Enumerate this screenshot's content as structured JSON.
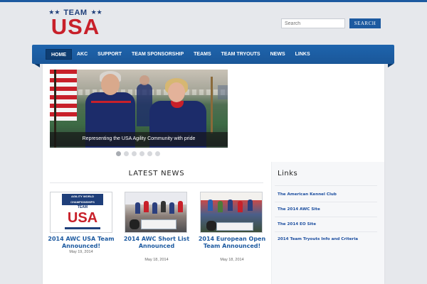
{
  "logo": {
    "team": "TEAM",
    "usa": "USA"
  },
  "search": {
    "placeholder": "Search",
    "button": "SEARCH"
  },
  "nav": {
    "items": [
      "Home",
      "AKC",
      "Support",
      "Team Sponsorship",
      "Teams",
      "Team Tryouts",
      "News",
      "Links"
    ],
    "active": "Home"
  },
  "slider": {
    "caption": "Representing the USA Agility Community with pride",
    "slides": 6,
    "active_index": 0
  },
  "news": {
    "heading": "Latest News",
    "thumb1": {
      "band": "AGILITY WORLD CHAMPIONSHIPS",
      "team": "TEAM",
      "usa": "USA"
    },
    "items": [
      {
        "title": "2014 AWC USA Team Announced!",
        "date": "May 19, 2014"
      },
      {
        "title": "2014 AWC Short List Announced",
        "date": "May 18, 2014"
      },
      {
        "title": "2014 European Open Team Announced!",
        "date": "May 18, 2014"
      }
    ]
  },
  "links": {
    "heading": "Links",
    "items": [
      "The American Kennel Club",
      "The 2014 AWC Site",
      "The 2014 EO Site",
      "2014 Team Tryouts Info and Criteria"
    ]
  },
  "colors": {
    "brand_blue": "#1d5aa0",
    "nav_active": "#0e3e73",
    "brand_red": "#c8202a",
    "link_blue": "#1d4fa0"
  }
}
